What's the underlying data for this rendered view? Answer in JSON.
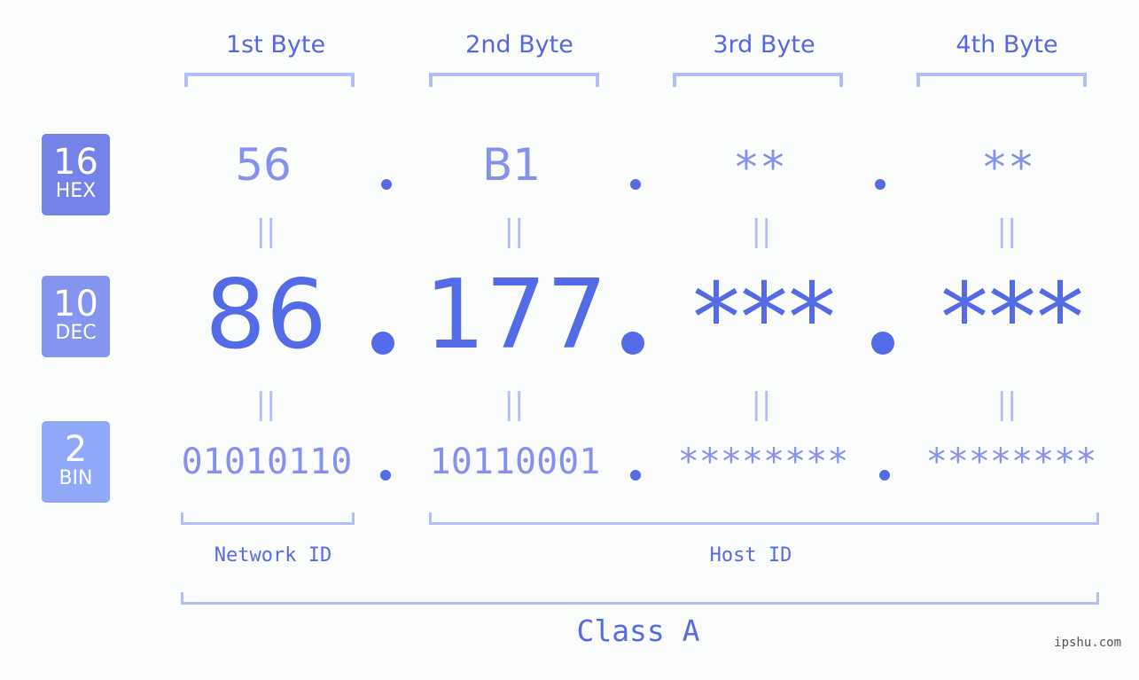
{
  "colors": {
    "hex_badge": "#7482ea",
    "dec_badge": "#8594ef",
    "bin_badge": "#8fa8f8",
    "accent": "#546be8",
    "light_value": "#8491ee",
    "bracket": "#b3bdf6"
  },
  "badges": [
    {
      "base": "16",
      "label": "HEX"
    },
    {
      "base": "10",
      "label": "DEC"
    },
    {
      "base": "2",
      "label": "BIN"
    }
  ],
  "byte_headers": [
    "1st Byte",
    "2nd Byte",
    "3rd Byte",
    "4th Byte"
  ],
  "hex_values": [
    "56",
    "B1",
    "**",
    "**"
  ],
  "dec_values": [
    "86",
    "177",
    "***",
    "***"
  ],
  "bin_values": [
    "01010110",
    "10110001",
    "********",
    "********"
  ],
  "equals_symbol": "||",
  "separator": ".",
  "network_label": "Network ID",
  "host_label": "Host ID",
  "class_label": "Class A",
  "watermark": "ipshu.com"
}
